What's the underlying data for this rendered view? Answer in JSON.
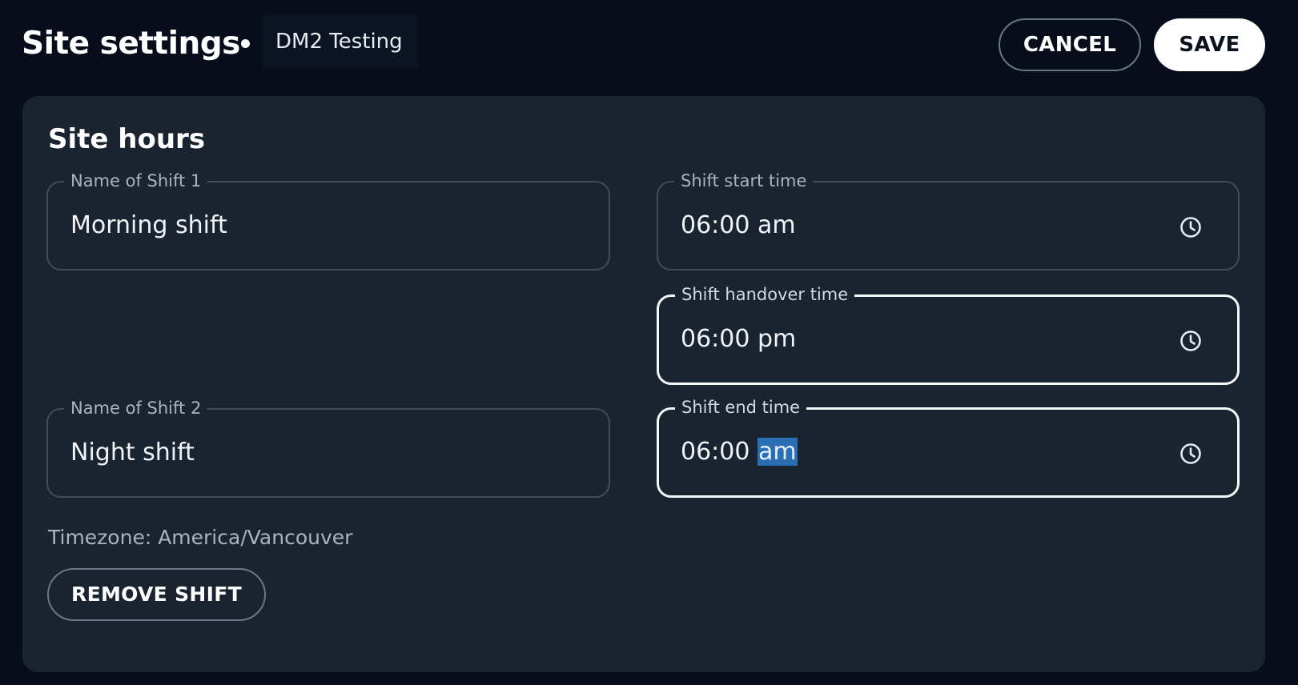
{
  "header": {
    "title": "Site settings",
    "site_name": "DM2 Testing",
    "cancel_label": "CANCEL",
    "save_label": "SAVE"
  },
  "site_hours": {
    "title": "Site hours",
    "shift1": {
      "name_label": "Name of Shift 1",
      "name_value": "Morning shift",
      "start_label": "Shift start time",
      "start_time": "06:00",
      "start_period": "am",
      "handover_label": "Shift handover time",
      "handover_time": "06:00",
      "handover_period": "pm"
    },
    "shift2": {
      "name_label": "Name of Shift 2",
      "name_value": "Night shift",
      "end_label": "Shift end time",
      "end_time": "06:00",
      "end_period": "am"
    },
    "timezone": "Timezone: America/Vancouver",
    "remove_label": "REMOVE SHIFT"
  },
  "icons": {
    "time_picker": "clock-icon"
  },
  "colors": {
    "background": "#070d1a",
    "card": "#1a2430",
    "selection": "#2a6fb4"
  }
}
